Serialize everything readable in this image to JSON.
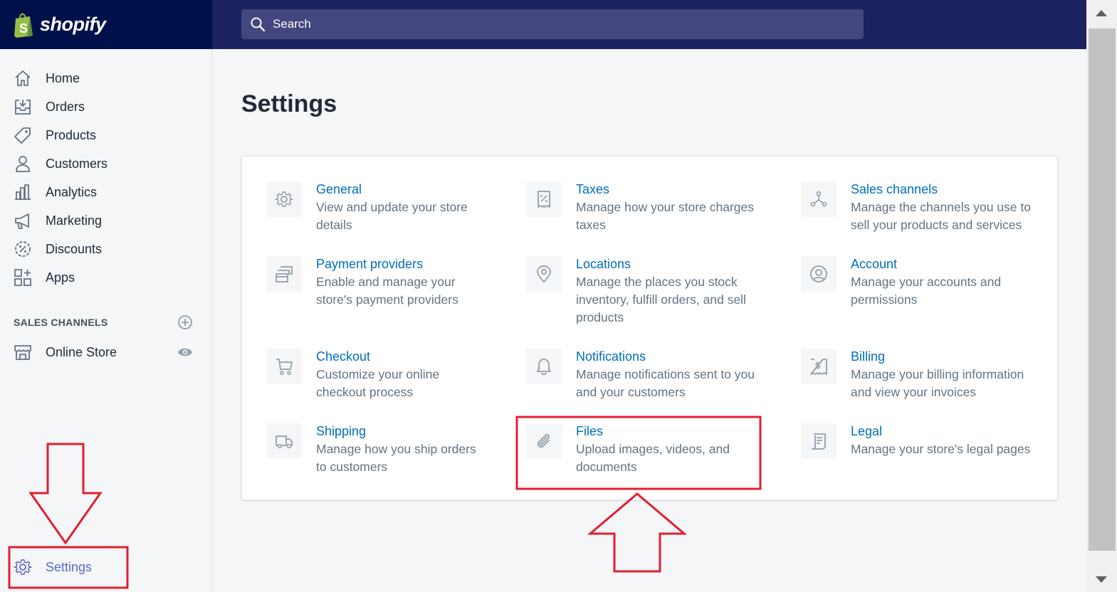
{
  "brand": {
    "name": "shopify"
  },
  "search": {
    "placeholder": "Search"
  },
  "sidebar": {
    "items": [
      {
        "label": "Home",
        "icon": "home-icon"
      },
      {
        "label": "Orders",
        "icon": "orders-icon"
      },
      {
        "label": "Products",
        "icon": "tag-icon"
      },
      {
        "label": "Customers",
        "icon": "person-icon"
      },
      {
        "label": "Analytics",
        "icon": "bar-chart-icon"
      },
      {
        "label": "Marketing",
        "icon": "megaphone-icon"
      },
      {
        "label": "Discounts",
        "icon": "discount-icon"
      },
      {
        "label": "Apps",
        "icon": "apps-icon"
      }
    ],
    "sales_channels_title": "SALES CHANNELS",
    "online_store": "Online Store",
    "settings": "Settings"
  },
  "page": {
    "title": "Settings"
  },
  "settings": [
    {
      "title": "General",
      "desc1": "View and update your store",
      "desc2": "details",
      "icon": "gear-icon"
    },
    {
      "title": "Taxes",
      "desc1": "Manage how your store charges",
      "desc2": "taxes",
      "icon": "receipt-icon"
    },
    {
      "title": "Sales channels",
      "desc1": "Manage the channels you use to",
      "desc2": "sell your products and services",
      "icon": "channels-icon"
    },
    {
      "title": "Payment providers",
      "desc1": "Enable and manage your",
      "desc2": "store's payment providers",
      "icon": "payment-icon"
    },
    {
      "title": "Locations",
      "desc1": "Manage the places you stock",
      "desc2": "inventory, fulfill orders, and sell",
      "desc3": "products",
      "icon": "location-pin-icon"
    },
    {
      "title": "Account",
      "desc1": "Manage your accounts and",
      "desc2": "permissions",
      "icon": "account-icon"
    },
    {
      "title": "Checkout",
      "desc1": "Customize your online",
      "desc2": "checkout process",
      "icon": "cart-icon"
    },
    {
      "title": "Notifications",
      "desc1": "Manage notifications sent to you",
      "desc2": "and your customers",
      "icon": "bell-icon"
    },
    {
      "title": "Billing",
      "desc1": "Manage your billing information",
      "desc2": "and view your invoices",
      "icon": "billing-icon"
    },
    {
      "title": "Shipping",
      "desc1": "Manage how you ship orders",
      "desc2": "to customers",
      "icon": "truck-icon"
    },
    {
      "title": "Files",
      "desc1": "Upload images, videos, and",
      "desc2": "documents",
      "icon": "paperclip-icon"
    },
    {
      "title": "Legal",
      "desc1": "Manage your store's legal pages",
      "icon": "legal-icon"
    }
  ],
  "colors": {
    "topbar": "#1c2260",
    "logo_bg": "#00104a",
    "link": "#006fbb",
    "annotation": "#e02030",
    "settings_active": "#5c6ac4"
  }
}
